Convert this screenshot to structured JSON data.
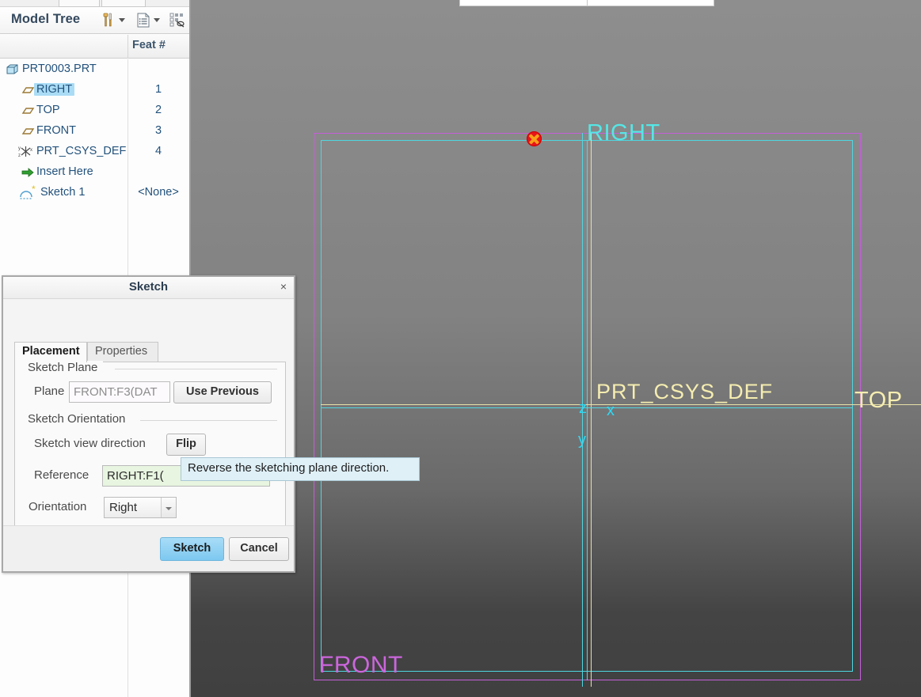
{
  "app": {
    "viewport_bg_top": "#8e8e8e",
    "viewport_bg_bottom": "#404040"
  },
  "tree": {
    "title": "Model Tree",
    "toolbar": [
      {
        "name": "settings-tools-icon",
        "glyph": "tools"
      },
      {
        "name": "display-list-icon",
        "glyph": "list"
      },
      {
        "name": "filter-hide-icon",
        "glyph": "filter"
      }
    ],
    "columns": {
      "name_header": "",
      "feat_header": "Feat #"
    },
    "rows": [
      {
        "label": "PRT0003.PRT",
        "feat": "",
        "icon": "part-icon",
        "indent": 0,
        "selected": false
      },
      {
        "label": "RIGHT",
        "feat": "1",
        "icon": "datum-plane-icon",
        "indent": 1,
        "selected": true
      },
      {
        "label": "TOP",
        "feat": "2",
        "icon": "datum-plane-icon",
        "indent": 1,
        "selected": false
      },
      {
        "label": "FRONT",
        "feat": "3",
        "icon": "datum-plane-icon",
        "indent": 1,
        "selected": false
      },
      {
        "label": "PRT_CSYS_DEF",
        "feat": "4",
        "icon": "csys-icon",
        "indent": 1,
        "selected": false
      },
      {
        "label": "Insert Here",
        "feat": "",
        "icon": "insert-arrow-icon",
        "indent": 1,
        "selected": false
      },
      {
        "label": "Sketch 1",
        "feat": "<None>",
        "icon": "sketch-icon",
        "indent": 1,
        "selected": false
      }
    ]
  },
  "dialog": {
    "title": "Sketch",
    "close_label": "×",
    "tabs": [
      {
        "label": "Placement",
        "active": true
      },
      {
        "label": "Properties",
        "active": false
      }
    ],
    "sketch_plane": {
      "group_title": "Sketch Plane",
      "plane_label": "Plane",
      "plane_value": "FRONT:F3(DAT",
      "use_previous_label": "Use Previous"
    },
    "sketch_orientation": {
      "group_title": "Sketch Orientation",
      "view_direction_label": "Sketch view direction",
      "flip_label": "Flip",
      "reference_label": "Reference",
      "reference_value": "RIGHT:F1(",
      "orientation_label": "Orientation",
      "orientation_value": "Right"
    },
    "footer": {
      "ok_label": "Sketch",
      "cancel_label": "Cancel"
    }
  },
  "tooltip": {
    "text": "Reverse the sketching plane direction."
  },
  "viewport": {
    "labels": [
      {
        "name": "right-plane-label",
        "text": "RIGHT",
        "color": "#55e6e6"
      },
      {
        "name": "top-plane-label",
        "text": "TOP",
        "color": "#f5edb0"
      },
      {
        "name": "front-plane-label",
        "text": "FRONT",
        "color": "#cc66dd"
      },
      {
        "name": "csys-label",
        "text": "PRT_CSYS_DEF",
        "color": "#f5edb0"
      },
      {
        "name": "axis-z-label",
        "text": "z",
        "color": "#2fd9f5"
      },
      {
        "name": "axis-x-label",
        "text": "x",
        "color": "#2fd9f5"
      },
      {
        "name": "axis-y-label",
        "text": "y",
        "color": "#2fd9f5"
      }
    ],
    "colors": {
      "front_plane": "#c45fd8",
      "top_plane": "#4fd6e0",
      "csys": "#e8e0a8",
      "marker": "#e8141b",
      "marker_cross": "#f7a01a"
    }
  }
}
